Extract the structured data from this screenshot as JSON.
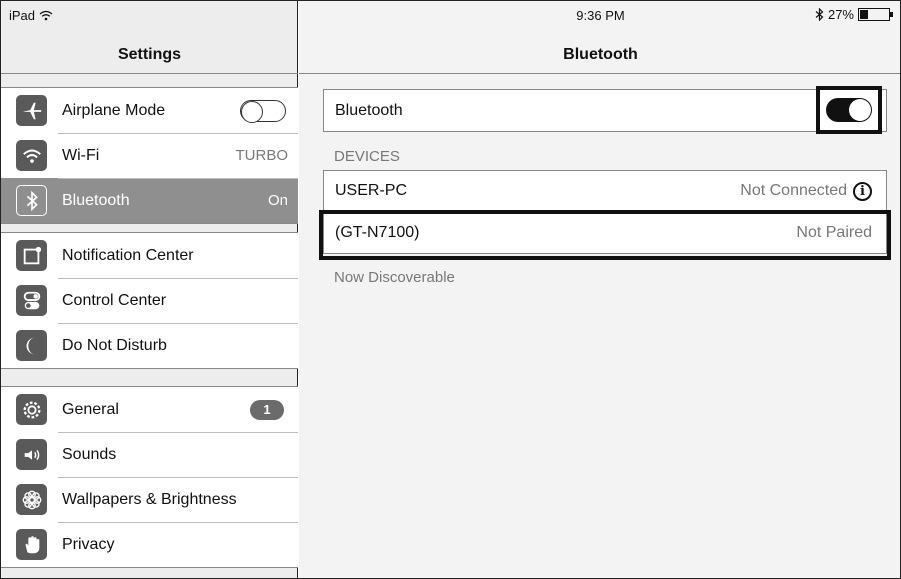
{
  "status": {
    "device": "iPad",
    "time": "9:36 PM",
    "battery": "27%",
    "battery_fraction": 0.27
  },
  "left": {
    "title": "Settings",
    "group1": [
      {
        "label": "Airplane Mode",
        "icon": "airplane-icon",
        "value": "",
        "toggle": "off"
      },
      {
        "label": "Wi-Fi",
        "icon": "wifi-icon",
        "value": "TURBO"
      },
      {
        "label": "Bluetooth",
        "icon": "bluetooth-icon",
        "value": "On",
        "selected": true
      }
    ],
    "group2": [
      {
        "label": "Notification Center",
        "icon": "notification-center-icon"
      },
      {
        "label": "Control Center",
        "icon": "control-center-icon"
      },
      {
        "label": "Do Not Disturb",
        "icon": "moon-icon"
      }
    ],
    "group3": [
      {
        "label": "General",
        "icon": "gear-icon",
        "badge": "1"
      },
      {
        "label": "Sounds",
        "icon": "speaker-icon"
      },
      {
        "label": "Wallpapers & Brightness",
        "icon": "flower-icon"
      },
      {
        "label": "Privacy",
        "icon": "hand-icon"
      }
    ]
  },
  "right": {
    "title": "Bluetooth",
    "bluetooth_label": "Bluetooth",
    "bluetooth_state": "on",
    "devices_header": "DEVICES",
    "devices": [
      {
        "name": "USER-PC",
        "status": "Not Connected"
      },
      {
        "name": "(GT-N7100)",
        "status": "Not Paired"
      }
    ],
    "footer": "Now Discoverable"
  },
  "colors": {
    "selected_row": "#8f8f8f",
    "icon_bg": "#5a5a5a",
    "panel_bg": "#ededed"
  }
}
